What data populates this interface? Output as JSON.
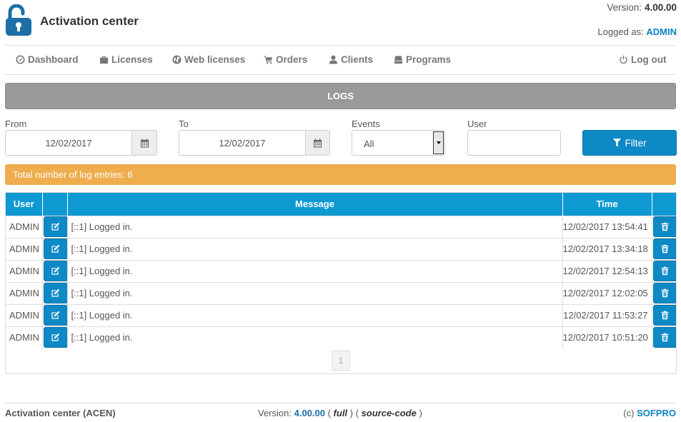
{
  "header": {
    "title": "Activation center",
    "version_label": "Version:",
    "version_value": "4.00.00",
    "logged_label": "Logged as:",
    "logged_user": "ADMIN"
  },
  "nav": {
    "items": [
      {
        "label": "Dashboard",
        "icon": "dashboard-icon"
      },
      {
        "label": "Licenses",
        "icon": "briefcase-icon"
      },
      {
        "label": "Web licenses",
        "icon": "globe-icon"
      },
      {
        "label": "Orders",
        "icon": "cart-icon"
      },
      {
        "label": "Clients",
        "icon": "user-icon"
      },
      {
        "label": "Programs",
        "icon": "hdd-icon"
      }
    ],
    "logout": {
      "label": "Log out",
      "icon": "power-icon"
    }
  },
  "page_title": "LOGS",
  "filters": {
    "from_label": "From",
    "from_value": "12/02/2017",
    "to_label": "To",
    "to_value": "12/02/2017",
    "events_label": "Events",
    "events_value": "All",
    "user_label": "User",
    "user_value": "",
    "filter_button": "Filter"
  },
  "total_text": "Total number of log entries: 6",
  "table": {
    "columns": [
      "User",
      "",
      "Message",
      "Time",
      ""
    ],
    "rows": [
      {
        "user": "ADMIN",
        "message": "[::1] Logged in.",
        "time": "12/02/2017 13:54:41"
      },
      {
        "user": "ADMIN",
        "message": "[::1] Logged in.",
        "time": "12/02/2017 13:34:18"
      },
      {
        "user": "ADMIN",
        "message": "[::1] Logged in.",
        "time": "12/02/2017 12:54:13"
      },
      {
        "user": "ADMIN",
        "message": "[::1] Logged in.",
        "time": "12/02/2017 12:02:05"
      },
      {
        "user": "ADMIN",
        "message": "[::1] Logged in.",
        "time": "12/02/2017 11:53:27"
      },
      {
        "user": "ADMIN",
        "message": "[::1] Logged in.",
        "time": "12/02/2017 10:51:20"
      }
    ]
  },
  "pager": {
    "current_page": "1"
  },
  "footer": {
    "app_name": "Activation center (ACEN)",
    "version_label": "Version:",
    "version_value": "4.00.00",
    "edition": "full",
    "source": "source-code",
    "copyright": "(c)",
    "company": "SOFPRO"
  },
  "colors": {
    "primary": "#0d89c6",
    "header_table": "#0f99d1",
    "warning": "#efad4d",
    "logs_bar": "#9a9a9a"
  }
}
